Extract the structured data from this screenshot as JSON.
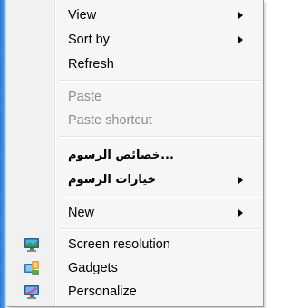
{
  "context_menu": {
    "items": [
      {
        "label": "View",
        "submenu": true,
        "enabled": true
      },
      {
        "label": "Sort by",
        "submenu": true,
        "enabled": true
      },
      {
        "label": "Refresh",
        "submenu": false,
        "enabled": true
      },
      {
        "label": "Paste",
        "submenu": false,
        "enabled": false
      },
      {
        "label": "Paste shortcut",
        "submenu": false,
        "enabled": false
      },
      {
        "label": "...خصائص الرسوم",
        "submenu": false,
        "enabled": true
      },
      {
        "label": "خيارات الرسوم",
        "submenu": true,
        "enabled": true
      },
      {
        "label": "New",
        "submenu": true,
        "enabled": true
      },
      {
        "label": "Screen resolution",
        "submenu": false,
        "enabled": true,
        "icon": "screen-resolution-icon"
      },
      {
        "label": "Gadgets",
        "submenu": false,
        "enabled": true,
        "icon": "gadgets-icon"
      },
      {
        "label": "Personalize",
        "submenu": false,
        "enabled": true,
        "icon": "personalize-icon"
      }
    ]
  },
  "colors": {
    "menu_background": "#f5f6f7",
    "disabled_text": "#8d8d8d",
    "desktop_accent": "#2a78d0"
  }
}
